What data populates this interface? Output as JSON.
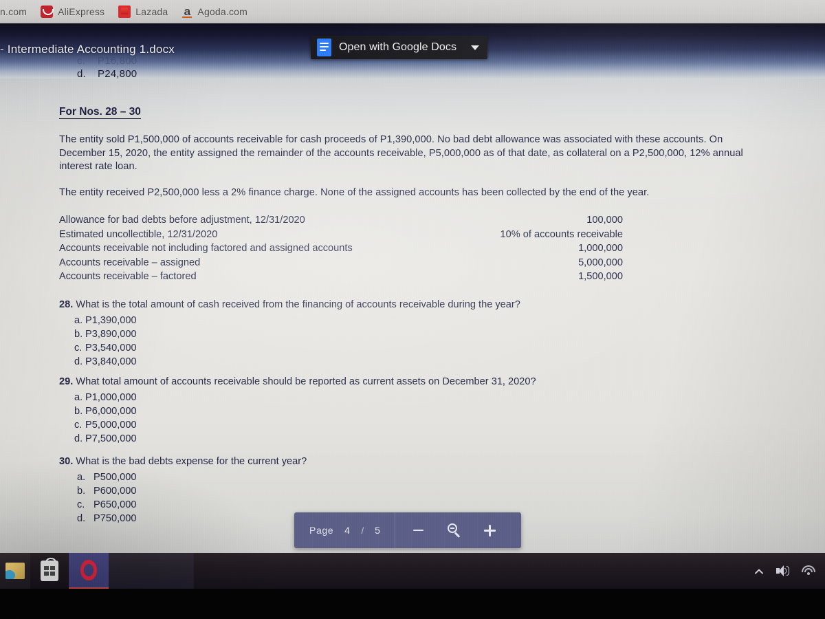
{
  "browser": {
    "bookmarks": [
      {
        "label": "n.com",
        "icon": ""
      },
      {
        "label": "AliExpress",
        "icon": "aliexpress-icon"
      },
      {
        "label": "Lazada",
        "icon": "lazada-icon"
      },
      {
        "label": "Agoda.com",
        "icon": "agoda-icon"
      }
    ]
  },
  "drive": {
    "file_title": "- Intermediate Accounting 1.docx",
    "open_with_label": "Open with Google Docs",
    "ghost_options": [
      {
        "letter": "c.",
        "value": "P16,800"
      },
      {
        "letter": "d.",
        "value": "P24,800"
      }
    ]
  },
  "document": {
    "section_heading": "For Nos. 28 – 30",
    "paragraph_1": "The entity sold P1,500,000 of accounts receivable for cash proceeds of P1,390,000. No bad debt allowance was associated with these accounts. On December 15, 2020, the entity assigned the remainder of the accounts receivable, P5,000,000 as of that date, as collateral on a P2,500,000, 12% annual interest rate loan.",
    "paragraph_2": "The entity received P2,500,000 less a 2% finance charge. None of the assigned accounts has been collected by the end of the year.",
    "figures": [
      {
        "label": "Allowance for bad debts before adjustment, 12/31/2020",
        "value": "100,000"
      },
      {
        "label": "Estimated uncollectible, 12/31/2020",
        "value": "10% of accounts receivable"
      },
      {
        "label": "Accounts receivable not including factored and assigned accounts",
        "value": "1,000,000"
      },
      {
        "label": "Accounts receivable – assigned",
        "value": "5,000,000"
      },
      {
        "label": "Accounts receivable – factored",
        "value": "1,500,000"
      }
    ],
    "questions": [
      {
        "number": "28.",
        "text": "What is the total amount of cash received from the financing of accounts receivable during the year?",
        "options": [
          {
            "letter": "a.",
            "value": "P1,390,000"
          },
          {
            "letter": "b.",
            "value": "P3,890,000"
          },
          {
            "letter": "c.",
            "value": "P3,540,000"
          },
          {
            "letter": "d.",
            "value": "P3,840,000"
          }
        ]
      },
      {
        "number": "29.",
        "text": "What total amount of accounts receivable should be reported as current assets on December 31, 2020?",
        "options": [
          {
            "letter": "a.",
            "value": "P1,000,000"
          },
          {
            "letter": "b.",
            "value": "P6,000,000"
          },
          {
            "letter": "c.",
            "value": "P5,000,000"
          },
          {
            "letter": "d.",
            "value": "P7,500,000"
          }
        ]
      },
      {
        "number": "30.",
        "text": "What is the bad debts expense for the current year?",
        "options": [
          {
            "letter": "a.",
            "value": "P500,000"
          },
          {
            "letter": "b.",
            "value": "P600,000"
          },
          {
            "letter": "c.",
            "value": "P650,000"
          },
          {
            "letter": "d.",
            "value": "P750,000"
          }
        ]
      }
    ]
  },
  "viewer_toolbar": {
    "page_label": "Page",
    "current_page": "4",
    "separator": "/",
    "total_pages": "5",
    "zoom_out_icon": "minus-icon",
    "zoom_reset_icon": "magnifier-icon",
    "zoom_in_icon": "plus-icon"
  },
  "taskbar": {
    "items": [
      {
        "name": "photos-icon"
      },
      {
        "name": "microsoft-store-icon"
      },
      {
        "name": "opera-browser-icon"
      }
    ],
    "tray": [
      {
        "name": "show-hidden-icons-chevron"
      },
      {
        "name": "volume-icon"
      },
      {
        "name": "network-wifi-icon"
      }
    ]
  },
  "colors": {
    "accent_blue": "#2f7cf6",
    "toolbar_bg": "#5b5e86",
    "doc_text": "#232744",
    "chip_bg": "#1b1b20"
  }
}
